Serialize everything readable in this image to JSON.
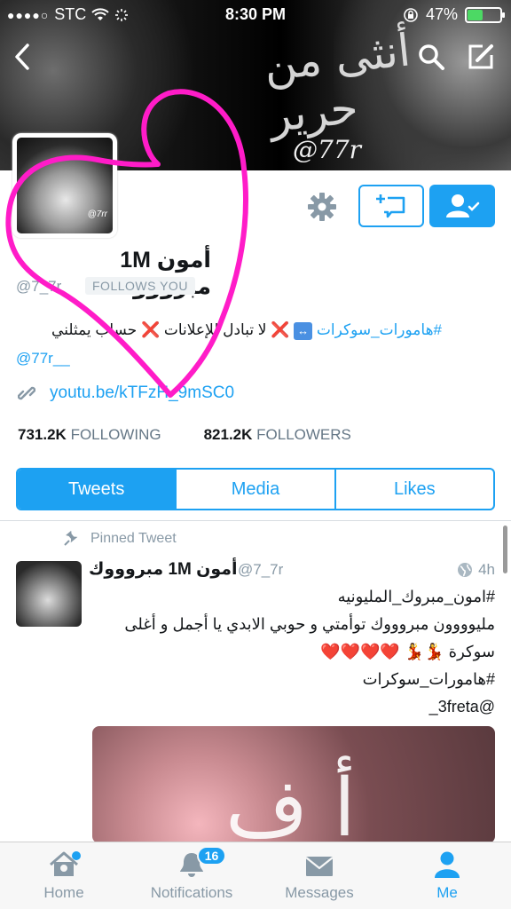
{
  "status_bar": {
    "carrier": "STC",
    "signal_dots": "●●●●○",
    "time": "8:30 PM",
    "battery_percent": "47%",
    "battery_level": 0.47
  },
  "header": {
    "banner_art_text": "أنثى من حرير",
    "banner_handle": "@77r"
  },
  "profile": {
    "avatar_watermark": "@7rr",
    "name": "أمون 1M مبروووك",
    "handle": "@7_7r",
    "follows_you": "FOLLOWS YOU",
    "bio_parts": {
      "hashtag": "#هامورات_سوكرات",
      "swap": "↔",
      "x1": "❌",
      "text1": "لا تبادل للإعلانات",
      "x2": "❌",
      "text2": "حساب يمثلني",
      "mention": "@77r__"
    },
    "website": "youtu.be/kTFzH_9mSC0",
    "following_count": "731.2K",
    "following_label": "FOLLOWING",
    "followers_count": "821.2K",
    "followers_label": "FOLLOWERS"
  },
  "tabs": [
    {
      "label": "Tweets",
      "active": true
    },
    {
      "label": "Media",
      "active": false
    },
    {
      "label": "Likes",
      "active": false
    }
  ],
  "pinned_tweet": {
    "pinned_label": "Pinned Tweet",
    "author_name": "أمون 1M مبروووك",
    "author_handle": "@7_7r",
    "time": "4h",
    "line1": "#امون_مبروك_المليونيه",
    "line2": "مليوووون مبروووك توأمتي و حوبي الابدي يا أجمل و أغلى",
    "line3_text": "سوكرة 💃💃",
    "line3_hearts": "❤️❤️❤️❤️",
    "line4": "#هامورات_سوكرات",
    "line5": "@3freta_",
    "media_overlay": "أ ف"
  },
  "tab_bar": [
    {
      "label": "Home",
      "icon": "home-icon",
      "active": false,
      "dot": true
    },
    {
      "label": "Notifications",
      "icon": "bell-icon",
      "active": false,
      "badge": "16"
    },
    {
      "label": "Messages",
      "icon": "envelope-icon",
      "active": false
    },
    {
      "label": "Me",
      "icon": "person-icon",
      "active": true
    }
  ],
  "colors": {
    "accent": "#1da1f2",
    "scribble": "#ff1cc8",
    "battery_fill": "#4cd964"
  }
}
